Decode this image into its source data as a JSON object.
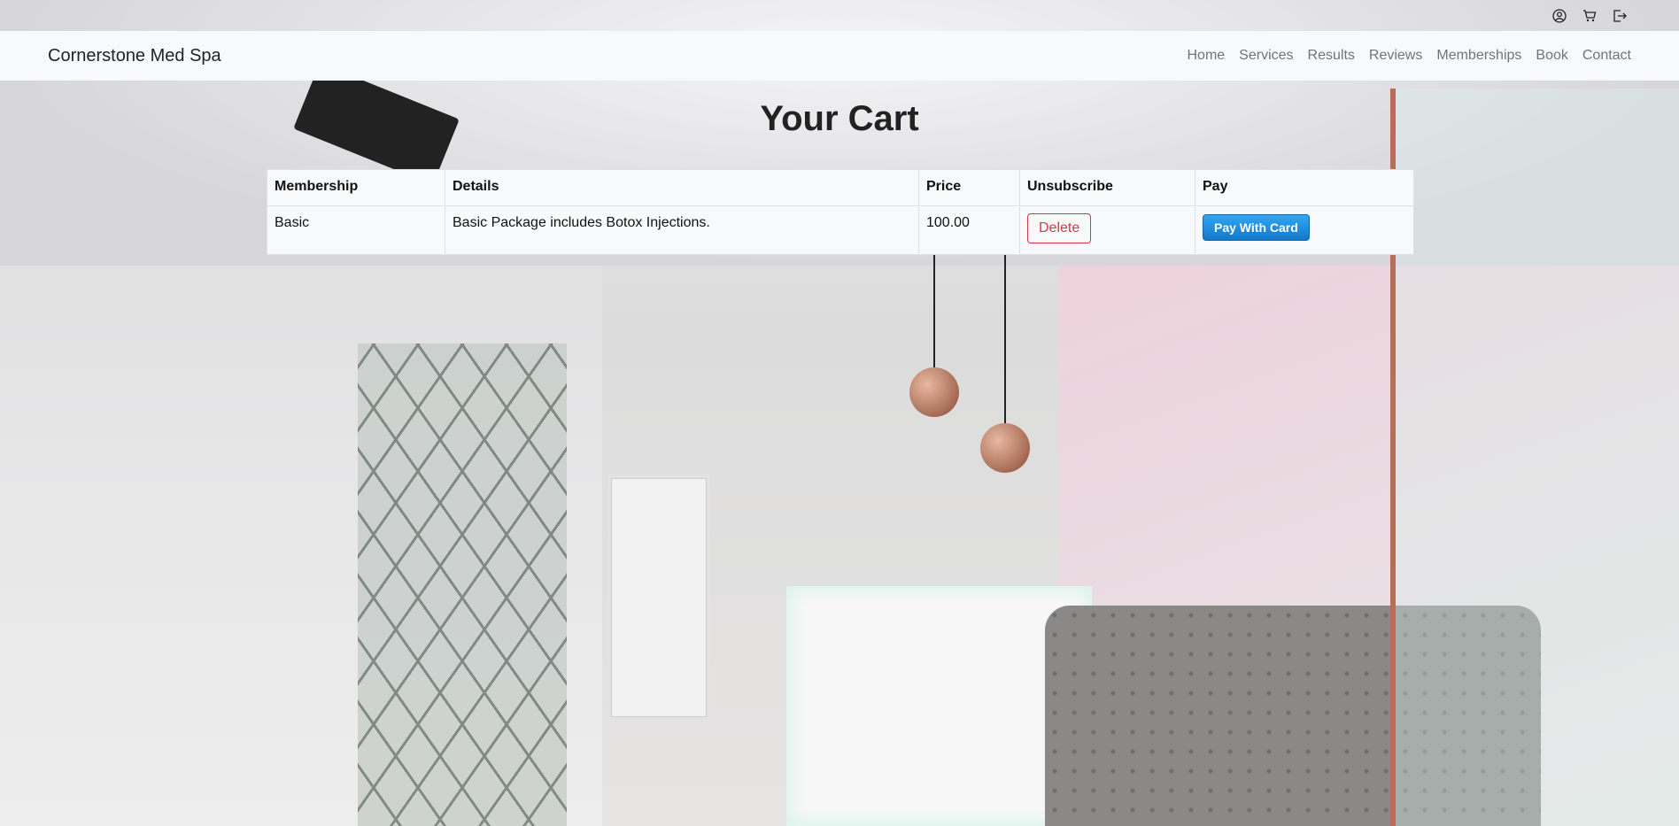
{
  "navbar": {
    "brand": "Cornerstone Med Spa",
    "links": [
      "Home",
      "Services",
      "Results",
      "Reviews",
      "Memberships",
      "Book",
      "Contact"
    ]
  },
  "utility_icons": [
    "user-circle-icon",
    "cart-icon",
    "logout-icon"
  ],
  "page": {
    "title": "Your Cart"
  },
  "cart": {
    "headers": [
      "Membership",
      "Details",
      "Price",
      "Unsubscribe",
      "Pay"
    ],
    "rows": [
      {
        "membership": "Basic",
        "details": "Basic Package includes Botox Injections.",
        "price": "100.00",
        "unsubscribe_label": "Delete",
        "pay_label": "Pay With Card"
      }
    ]
  },
  "colors": {
    "delete": "#dc3545",
    "pay": "#1a8ad9",
    "navbar_bg": "#f8f9fa"
  }
}
